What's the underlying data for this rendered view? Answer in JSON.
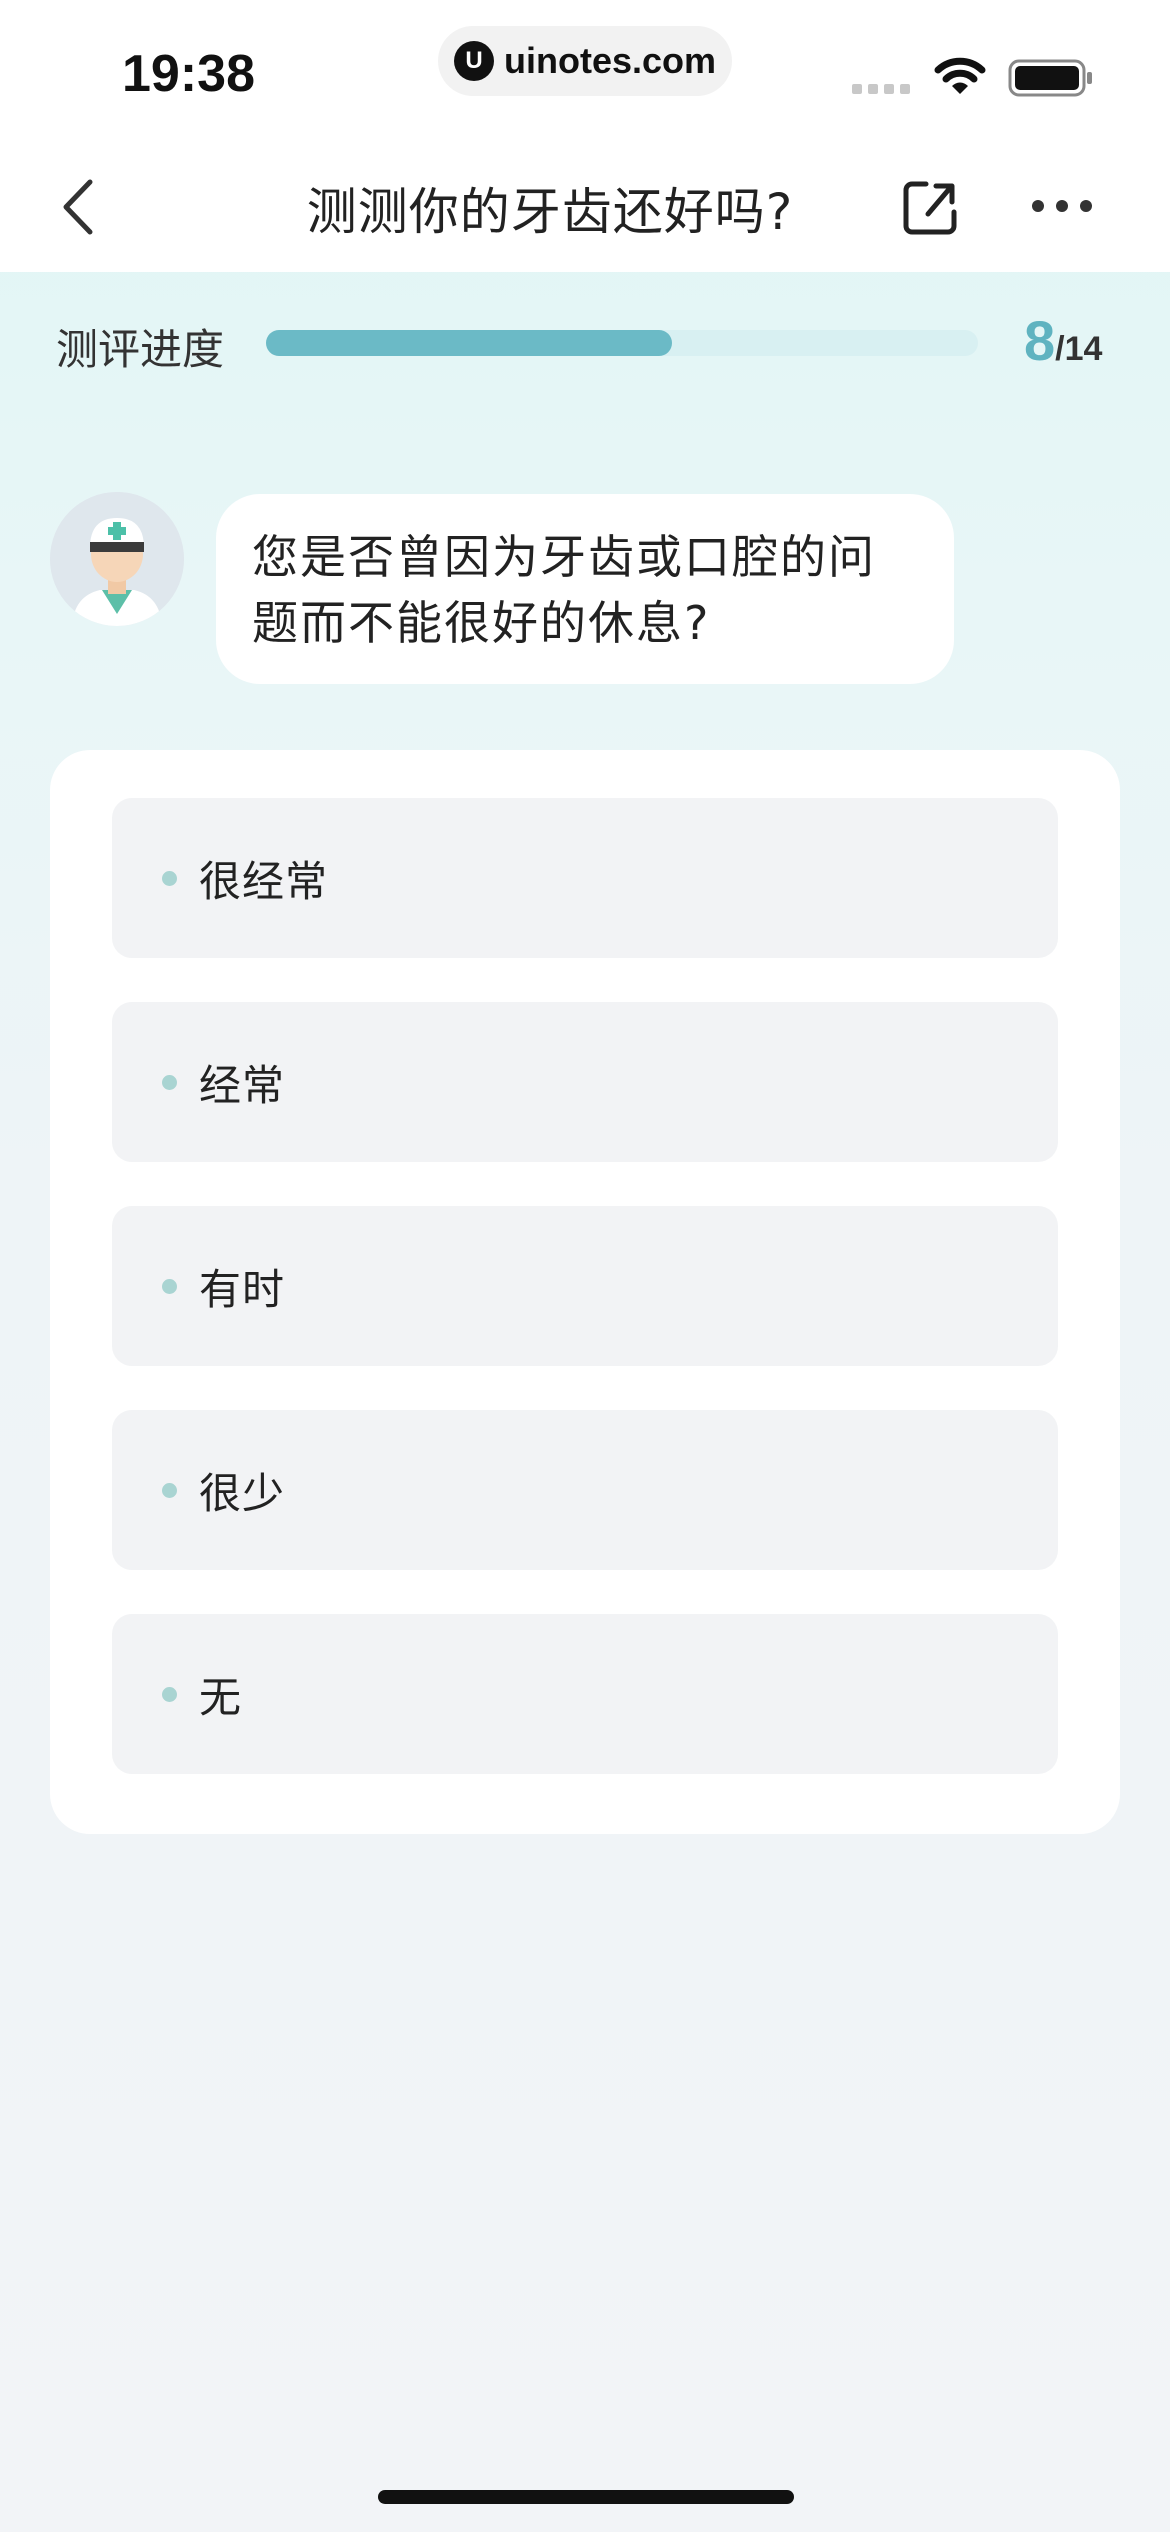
{
  "status_bar": {
    "time": "19:38",
    "url": "uinotes.com",
    "url_logo": "U"
  },
  "nav": {
    "title": "测测你的牙齿还好吗?",
    "back_icon": "chevron-left-icon",
    "share_icon": "share-icon",
    "more_icon": "more-horizontal-icon"
  },
  "progress": {
    "label": "测评进度",
    "current": "8",
    "total": "/14",
    "fraction": 0.57
  },
  "question": {
    "avatar_icon": "doctor-avatar",
    "text": "您是否曾因为牙齿或口腔的问题而不能很好的休息?"
  },
  "options": [
    {
      "label": "很经常"
    },
    {
      "label": "经常"
    },
    {
      "label": "有时"
    },
    {
      "label": "很少"
    },
    {
      "label": "无"
    }
  ],
  "colors": {
    "accent": "#5fb3c0",
    "progress_fill": "#6bbac6",
    "progress_track": "#d8f0f2",
    "option_bg": "#f2f3f5",
    "option_dot": "#a9d4d2"
  }
}
